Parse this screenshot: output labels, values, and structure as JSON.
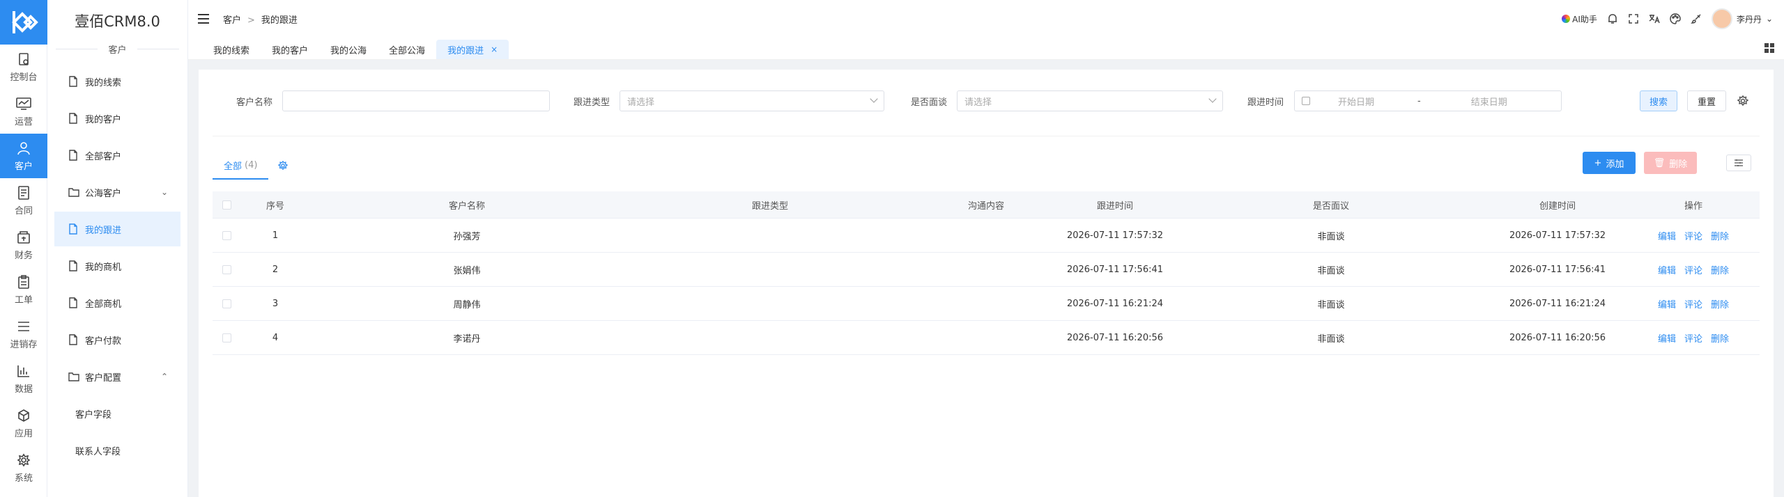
{
  "rail": {
    "items": [
      {
        "label": "控制台",
        "icon": "dashboard-icon"
      },
      {
        "label": "运营",
        "icon": "operations-icon"
      },
      {
        "label": "客户",
        "icon": "customer-icon",
        "active": true
      },
      {
        "label": "合同",
        "icon": "contract-icon"
      },
      {
        "label": "财务",
        "icon": "finance-icon"
      },
      {
        "label": "工单",
        "icon": "ticket-icon"
      },
      {
        "label": "进销存",
        "icon": "inventory-icon"
      },
      {
        "label": "数据",
        "icon": "data-icon"
      },
      {
        "label": "应用",
        "icon": "app-icon"
      },
      {
        "label": "系统",
        "icon": "system-icon"
      }
    ]
  },
  "subnav": {
    "title": "壹佰CRM8.0",
    "section": "客户",
    "items": [
      {
        "label": "我的线索"
      },
      {
        "label": "我的客户"
      },
      {
        "label": "全部客户"
      },
      {
        "label": "公海客户",
        "chevron": "⌄"
      },
      {
        "label": "我的跟进",
        "active": true
      },
      {
        "label": "我的商机"
      },
      {
        "label": "全部商机"
      },
      {
        "label": "客户付款"
      },
      {
        "label": "客户配置",
        "chevron": "⌃"
      },
      {
        "label": "客户字段"
      },
      {
        "label": "联系人字段"
      }
    ]
  },
  "header": {
    "breadcrumb": [
      "客户",
      "我的跟进"
    ],
    "ai_label": "AI助手",
    "user_name": "李丹丹"
  },
  "tabs": [
    {
      "label": "我的线索"
    },
    {
      "label": "我的客户"
    },
    {
      "label": "我的公海"
    },
    {
      "label": "全部公海"
    },
    {
      "label": "我的跟进",
      "active": true,
      "close": "×"
    }
  ],
  "filters": {
    "name_label": "客户名称",
    "name_value": "",
    "type_label": "跟进类型",
    "type_placeholder": "请选择",
    "face_label": "是否面谈",
    "face_placeholder": "请选择",
    "time_label": "跟进时间",
    "start_placeholder": "开始日期",
    "date_sep": "-",
    "end_placeholder": "结束日期",
    "search_label": "搜索",
    "reset_label": "重置"
  },
  "list": {
    "tab_label": "全部",
    "tab_count": "(4)",
    "add_label": "添加",
    "delete_label": "删除"
  },
  "table": {
    "headers": [
      "序号",
      "客户名称",
      "跟进类型",
      "沟通内容",
      "跟进时间",
      "是否面议",
      "创建时间",
      "操作"
    ],
    "ops": [
      "编辑",
      "评论",
      "删除"
    ],
    "rows": [
      {
        "seq": "1",
        "name": "孙强芳",
        "type": "",
        "comm": "",
        "time": "2026-07-11 17:57:32",
        "face": "非面谈",
        "created": "2026-07-11 17:57:32"
      },
      {
        "seq": "2",
        "name": "张娟伟",
        "type": "",
        "comm": "",
        "time": "2026-07-11 17:56:41",
        "face": "非面谈",
        "created": "2026-07-11 17:56:41"
      },
      {
        "seq": "3",
        "name": "周静伟",
        "type": "",
        "comm": "",
        "time": "2026-07-11 16:21:24",
        "face": "非面谈",
        "created": "2026-07-11 16:21:24"
      },
      {
        "seq": "4",
        "name": "李诺丹",
        "type": "",
        "comm": "",
        "time": "2026-07-11 16:20:56",
        "face": "非面谈",
        "created": "2026-07-11 16:20:56"
      }
    ]
  },
  "colors": {
    "primary": "#2d8cf0",
    "danger_light": "#fbbcbc",
    "active_bg": "#e8f2fe"
  }
}
